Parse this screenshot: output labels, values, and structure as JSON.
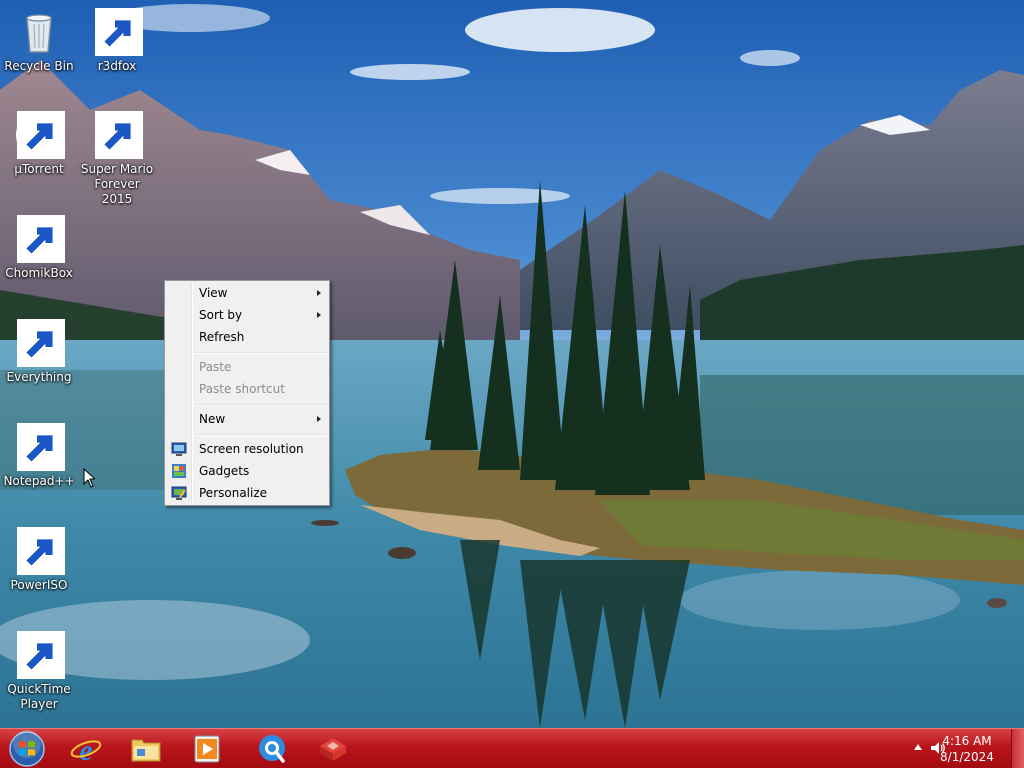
{
  "desktop": {
    "icons": [
      {
        "label": "Recycle Bin",
        "icon": "recycle-bin-icon",
        "shortcut": false
      },
      {
        "label": "r3dfox",
        "icon": "r3dfox-icon",
        "shortcut": true
      },
      {
        "label": "µTorrent",
        "icon": "utorrent-icon",
        "shortcut": true
      },
      {
        "label": "Super Mario Forever 2015",
        "icon": "mario-icon",
        "shortcut": true
      },
      {
        "label": "ChomikBox",
        "icon": "chomikbox-icon",
        "shortcut": true
      },
      {
        "label": "Everything",
        "icon": "everything-icon",
        "shortcut": true
      },
      {
        "label": "Notepad++",
        "icon": "notepadpp-icon",
        "shortcut": true
      },
      {
        "label": "PowerISO",
        "icon": "poweriso-icon",
        "shortcut": true
      },
      {
        "label": "QuickTime Player",
        "icon": "quicktime-icon",
        "shortcut": true
      }
    ]
  },
  "context_menu": {
    "items": [
      {
        "label": "View",
        "enabled": true,
        "submenu": true
      },
      {
        "label": "Sort by",
        "enabled": true,
        "submenu": true
      },
      {
        "label": "Refresh",
        "enabled": true,
        "submenu": false
      },
      {
        "label": "Paste",
        "enabled": false,
        "submenu": false
      },
      {
        "label": "Paste shortcut",
        "enabled": false,
        "submenu": false
      },
      {
        "label": "New",
        "enabled": true,
        "submenu": true
      },
      {
        "label": "Screen resolution",
        "enabled": true,
        "submenu": false,
        "icon": "screen-resolution-icon"
      },
      {
        "label": "Gadgets",
        "enabled": true,
        "submenu": false,
        "icon": "gadgets-icon"
      },
      {
        "label": "Personalize",
        "enabled": true,
        "submenu": false,
        "icon": "personalize-icon"
      }
    ]
  },
  "taskbar": {
    "pinned": [
      {
        "name": "internet-explorer-icon"
      },
      {
        "name": "file-explorer-icon"
      },
      {
        "name": "media-player-icon"
      },
      {
        "name": "quicktime-taskbar-icon"
      },
      {
        "name": "r3dfox-taskbar-icon"
      }
    ],
    "clock": {
      "time": "4:16 AM",
      "date": "8/1/2024"
    }
  },
  "colors": {
    "taskbar": "#b8151b",
    "menu_bg": "#f0f0f0",
    "disabled_text": "#8d8d8d"
  }
}
